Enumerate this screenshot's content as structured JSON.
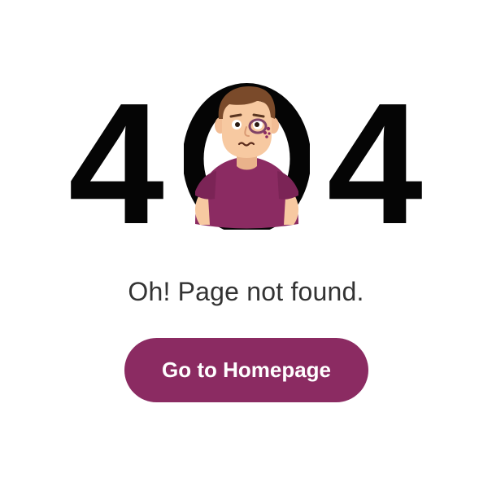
{
  "error": {
    "digit_left": "4",
    "digit_right": "4",
    "middle_icon": "sad-person-avatar-icon"
  },
  "message": "Oh! Page not found.",
  "button": {
    "label": "Go to Homepage"
  },
  "colors": {
    "accent": "#8b2b62",
    "digits": "#050505",
    "text": "#333333",
    "background": "#ffffff"
  }
}
